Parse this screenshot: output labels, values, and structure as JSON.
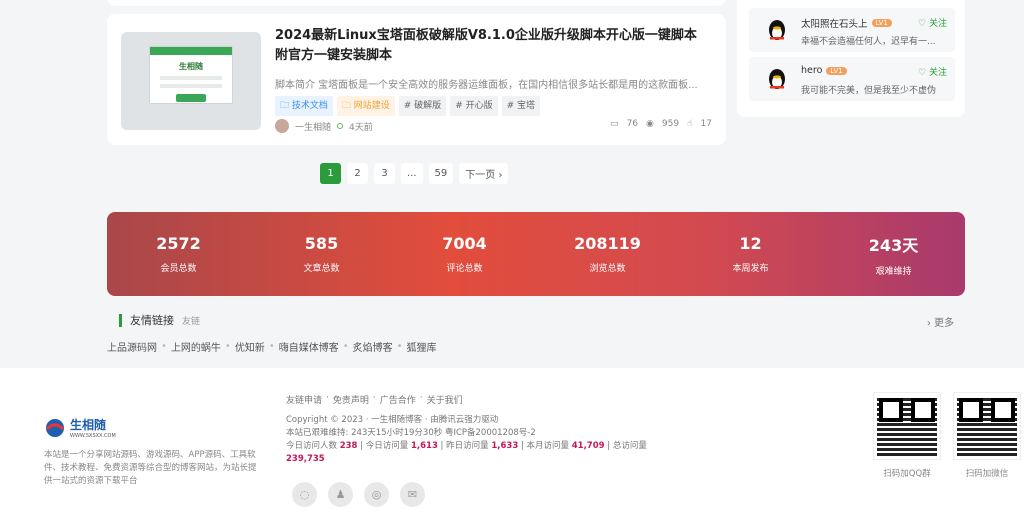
{
  "post": {
    "title": "2024最新Linux宝塔面板破解版V8.1.0企业版升级脚本开心版一键脚本 附官方一键安装脚本",
    "summary": "脚本简介 宝塔面板是一个安全高效的服务器运维面板，在国内相信很多站长都是用的这款面板...",
    "tags": [
      "技术文档",
      "网站建设",
      "# 破解版",
      "# 开心版",
      "# 宝塔"
    ],
    "author": "一生相随",
    "time": "4天前",
    "comments": "76",
    "views": "959",
    "likes": "17",
    "thumb_logo": "生相随"
  },
  "sidebar": {
    "users": [
      {
        "name": "太阳照在石头上",
        "level": "LV1",
        "follow": "关注",
        "text": "幸福不会造福任何人，迟早有一..."
      },
      {
        "name": "hero",
        "level": "LV1",
        "follow": "关注",
        "text": "我可能不完美，但是我至少不虚伪"
      }
    ]
  },
  "pagination": {
    "pages": [
      "1",
      "2",
      "3",
      "...",
      "59"
    ],
    "next": "下一页 ›"
  },
  "stats": [
    {
      "num": "2572",
      "label": "会员总数"
    },
    {
      "num": "585",
      "label": "文章总数"
    },
    {
      "num": "7004",
      "label": "评论总数"
    },
    {
      "num": "208119",
      "label": "浏览总数"
    },
    {
      "num": "12",
      "label": "本周发布"
    },
    {
      "num": "243天",
      "label": "艰难维持"
    }
  ],
  "links_section": {
    "title": "友情链接",
    "subtitle": "友链",
    "more": "› 更多",
    "items": [
      "上品源码网",
      "上网的蜗牛",
      "优知新",
      "嗨自媒体博客",
      "炙焰博客",
      "狐狸库"
    ]
  },
  "footer": {
    "logo_text": "生相随",
    "logo_url": "WWW.SXSXX.COM",
    "description": "本站是一个分享网站源码、游戏源码、APP源码、工具软件、技术教程、免费资源等综合型的博客网站，为站长提供一站式的资源下载平台",
    "links": [
      "友链申请",
      "免责声明",
      "广告合作",
      "关于我们"
    ],
    "copyright": "Copyright © 2023 · 一生相随博客 · 由腾讯云强力驱动",
    "runtime": "本站已艰难维持: 243天15小时19分30秒    粤ICP备20001208号-2",
    "visits": {
      "today_visitors_label": "今日访问人数",
      "today_visitors": "238",
      "today_views_label": "今日访问量",
      "today_views": "1,613",
      "yesterday_label": "昨日访问量",
      "yesterday": "1,633",
      "month_label": "本月访问量",
      "month": "41,709",
      "total_label": "总访问量",
      "total": "239,735"
    },
    "qr1_caption": "扫码加QQ群",
    "qr2_caption": "扫码加微信"
  }
}
